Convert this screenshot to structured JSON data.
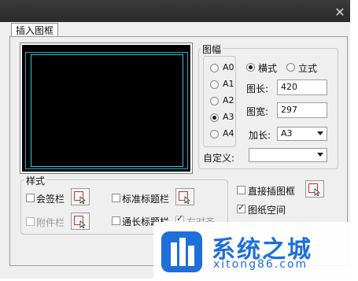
{
  "window": {
    "close_glyph": "✕"
  },
  "tab": {
    "label": "插入图框"
  },
  "frame": {
    "group_title": "图幅",
    "sizes": [
      {
        "label": "A0",
        "checked": false
      },
      {
        "label": "A1",
        "checked": false
      },
      {
        "label": "A2",
        "checked": false
      },
      {
        "label": "A3",
        "checked": true
      },
      {
        "label": "A4",
        "checked": false
      }
    ],
    "orientation": [
      {
        "label": "横式",
        "checked": true
      },
      {
        "label": "立式",
        "checked": false
      }
    ],
    "length_label": "图长:",
    "length_value": "420",
    "width_label": "图宽:",
    "width_value": "297",
    "extend_label": "加长:",
    "extend_value": "A3",
    "custom_label": "自定义:",
    "custom_value": ""
  },
  "style": {
    "group_title": "样式",
    "sign_bar": "会签栏",
    "standard_title": "标准标题栏",
    "attach_bar": "附件栏",
    "long_title": "通长标题栏",
    "right_align": "右对齐"
  },
  "options": {
    "direct_insert": "直接插图框",
    "paper_space": "图纸空间",
    "paper_space_checked": true,
    "direct_insert_checked": false
  },
  "watermark": {
    "brand": "系统之城",
    "site": "xitong86.com"
  }
}
